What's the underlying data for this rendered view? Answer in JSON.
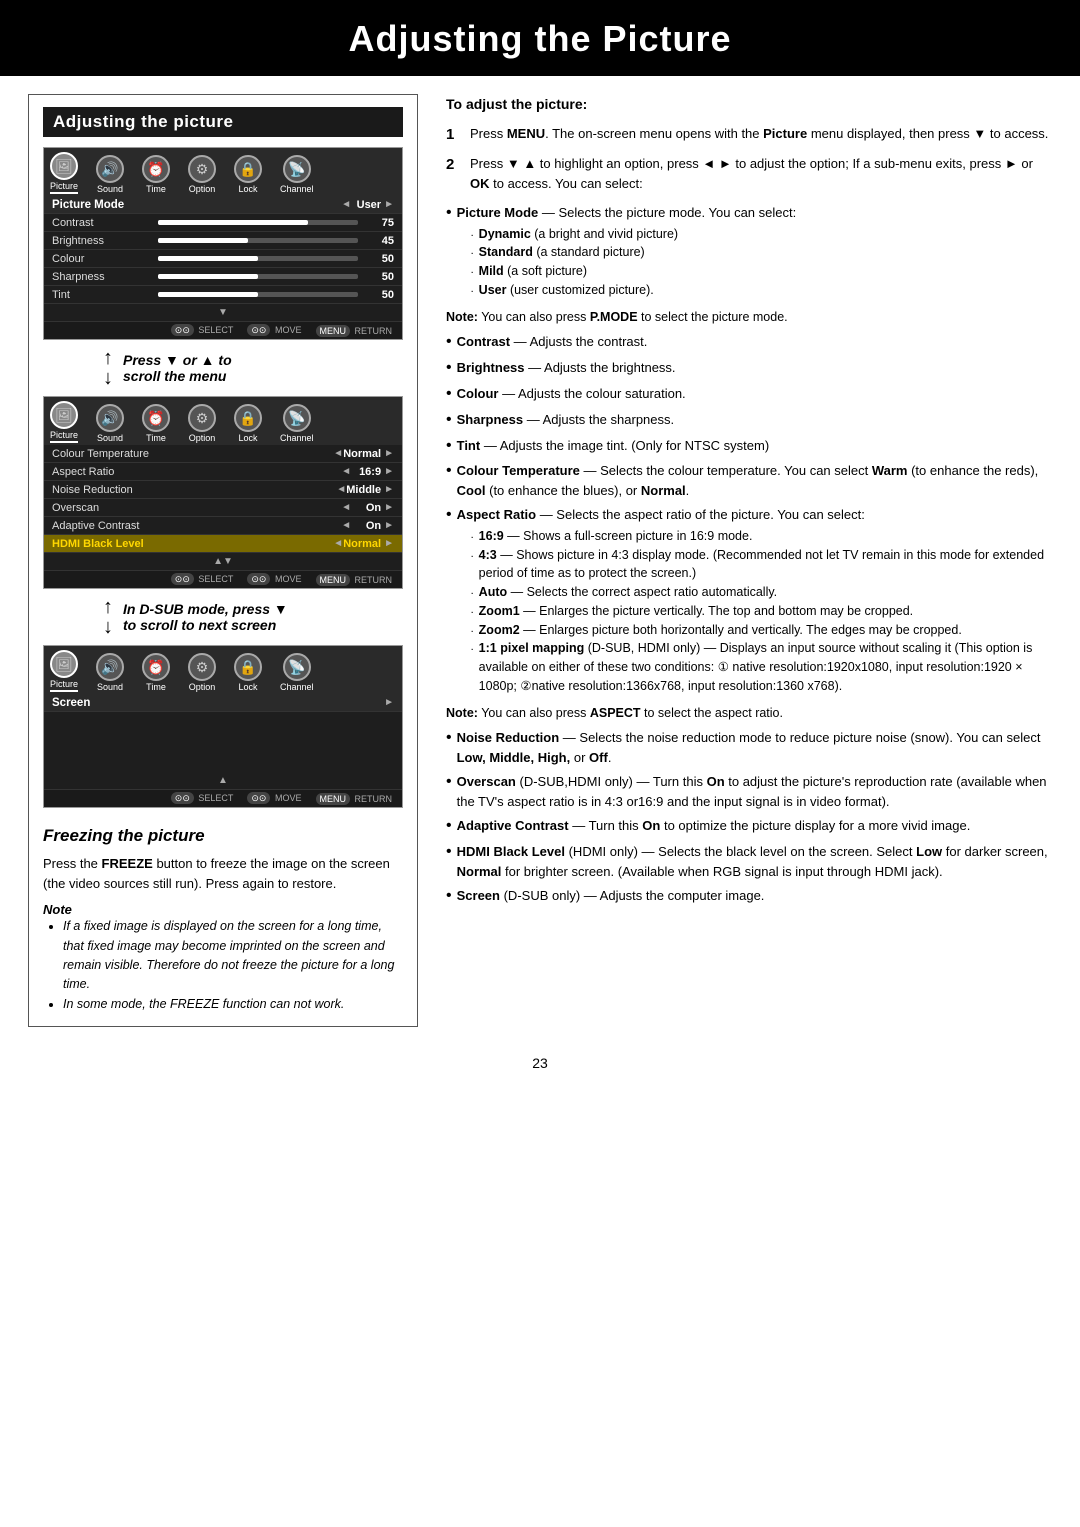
{
  "page": {
    "title": "Adjusting the Picture",
    "number": "23"
  },
  "left_section": {
    "header": "Adjusting the picture",
    "menu1": {
      "icons": [
        {
          "label": "Picture",
          "active": true
        },
        {
          "label": "Sound",
          "active": false
        },
        {
          "label": "Time",
          "active": false
        },
        {
          "label": "Option",
          "active": false
        },
        {
          "label": "Lock",
          "active": false
        },
        {
          "label": "Channel",
          "active": false
        }
      ],
      "rows": [
        {
          "label": "Picture Mode",
          "left_arrow": true,
          "value": "User",
          "right_arrow": true,
          "bar": false,
          "highlight": false,
          "bold_label": true
        },
        {
          "label": "Contrast",
          "left_arrow": false,
          "value": "75",
          "bar": true,
          "bar_pct": 75,
          "highlight": false,
          "bold_label": false
        },
        {
          "label": "Brightness",
          "left_arrow": false,
          "value": "45",
          "bar": true,
          "bar_pct": 45,
          "highlight": false,
          "bold_label": false
        },
        {
          "label": "Colour",
          "left_arrow": false,
          "value": "50",
          "bar": true,
          "bar_pct": 50,
          "highlight": false,
          "bold_label": false
        },
        {
          "label": "Sharpness",
          "left_arrow": false,
          "value": "50",
          "bar": true,
          "bar_pct": 50,
          "highlight": false,
          "bold_label": false
        },
        {
          "label": "Tint",
          "left_arrow": false,
          "value": "50",
          "bar": true,
          "bar_pct": 50,
          "highlight": false,
          "bold_label": false
        }
      ],
      "bottom": [
        "SELECT",
        "MOVE",
        "RETURN"
      ]
    },
    "scroll1": {
      "text1": "Press",
      "arrow": "↕",
      "text2": "or",
      "arrow2": "↑",
      "text3": "to",
      "text4": "scroll the menu"
    },
    "menu2": {
      "icons": [
        {
          "label": "Picture",
          "active": true
        },
        {
          "label": "Sound",
          "active": false
        },
        {
          "label": "Time",
          "active": false
        },
        {
          "label": "Option",
          "active": false
        },
        {
          "label": "Lock",
          "active": false
        },
        {
          "label": "Channel",
          "active": false
        }
      ],
      "rows": [
        {
          "label": "Colour Temperature",
          "left_arrow": true,
          "value": "Normal",
          "right_arrow": true,
          "bar": false,
          "highlight": false,
          "bold_label": false
        },
        {
          "label": "Aspect Ratio",
          "left_arrow": true,
          "value": "16:9",
          "right_arrow": true,
          "bar": false,
          "highlight": false,
          "bold_label": false
        },
        {
          "label": "Noise Reduction",
          "left_arrow": true,
          "value": "Middle",
          "right_arrow": true,
          "bar": false,
          "highlight": false,
          "bold_label": false
        },
        {
          "label": "Overscan",
          "left_arrow": true,
          "value": "On",
          "right_arrow": true,
          "bar": false,
          "highlight": false,
          "bold_label": false
        },
        {
          "label": "Adaptive Contrast",
          "left_arrow": true,
          "value": "On",
          "right_arrow": true,
          "bar": false,
          "highlight": false,
          "bold_label": false
        },
        {
          "label": "HDMI Black Level",
          "left_arrow": true,
          "value": "Normal",
          "right_arrow": true,
          "bar": false,
          "highlight": true,
          "bold_label": false,
          "highlight_color": "#b8860b"
        }
      ],
      "bottom": [
        "SELECT",
        "MOVE",
        "RETURN"
      ]
    },
    "scroll2": {
      "text": "In D-SUB mode, press ▼ to scroll to next screen"
    },
    "menu3": {
      "icons": [
        {
          "label": "Picture",
          "active": true
        },
        {
          "label": "Sound",
          "active": false
        },
        {
          "label": "Time",
          "active": false
        },
        {
          "label": "Option",
          "active": false
        },
        {
          "label": "Lock",
          "active": false
        },
        {
          "label": "Channel",
          "active": false
        }
      ],
      "rows": [
        {
          "label": "Screen",
          "value": "",
          "right_arrow": true,
          "bar": false,
          "highlight": false,
          "bold_label": false
        }
      ],
      "bottom": [
        "SELECT",
        "MOVE",
        "RETURN"
      ]
    }
  },
  "freezing_section": {
    "title": "Freezing the picture",
    "text": "Press the FREEZE button to freeze the image on the screen (the video sources still run). Press again to restore.",
    "note_title": "Note",
    "notes": [
      "If a fixed image is displayed on the screen for a long time, that fixed image may become imprinted on the screen and remain visible. Therefore do not freeze the picture for a long time.",
      "In some mode, the FREEZE function can not work."
    ]
  },
  "right_section": {
    "section_title": "To adjust the picture:",
    "steps": [
      {
        "num": "1",
        "text": "Press MENU. The on-screen menu opens with the Picture menu displayed, then press ▼ to access."
      },
      {
        "num": "2",
        "text": "Press ▼ ▲ to highlight an option, press ◄ ► to adjust the option; If a sub-menu exits, press ► or OK to access. You can select:"
      }
    ],
    "bullets": [
      {
        "main": "Picture Mode — Selects the picture mode. You can select:",
        "sub": [
          "Dynamic (a bright and vivid picture)",
          "Standard (a standard picture)",
          "Mild (a soft picture)",
          "User (user customized picture)."
        ]
      },
      {
        "main": "Note: You can also press P.MODE to select the picture mode.",
        "note": true,
        "sub": []
      },
      {
        "main": "Contrast — Adjusts the contrast.",
        "sub": []
      },
      {
        "main": "Brightness — Adjusts the brightness.",
        "sub": []
      },
      {
        "main": "Colour — Adjusts the colour saturation.",
        "sub": []
      },
      {
        "main": "Sharpness — Adjusts the sharpness.",
        "sub": []
      },
      {
        "main": "Tint — Adjusts the image tint. (Only for NTSC system)",
        "sub": []
      },
      {
        "main": "Colour Temperature — Selects the colour temperature. You can select Warm (to enhance the reds), Cool (to enhance the blues), or Normal.",
        "sub": []
      },
      {
        "main": "Aspect Ratio — Selects the aspect ratio of the picture. You can select:",
        "sub": [
          "16:9 — Shows a full-screen picture in 16:9 mode.",
          "4:3 — Shows picture in 4:3 display mode. (Recommended not let TV remain in this mode for extended period of time as to protect the screen.)",
          "Auto — Selects the correct aspect ratio automatically.",
          "Zoom1 — Enlarges the picture vertically. The top and bottom may be cropped.",
          "Zoom2 — Enlarges picture both horizontally and vertically. The edges may be cropped.",
          "1:1 pixel mapping (D-SUB, HDMI only) — Displays an input source without scaling it (This option is available on either of these two conditions: ① native resolution:1920x1080, input resolution:1920 × 1080p; ②native resolution:1366x768, input resolution:1360 x768)."
        ]
      },
      {
        "main": "Note: You can also press ASPECT to select the aspect ratio.",
        "note": true,
        "sub": []
      },
      {
        "main": "Noise Reduction — Selects the noise reduction mode to reduce picture noise (snow). You can select Low, Middle, High, or Off.",
        "sub": []
      },
      {
        "main": "Overscan (D-SUB,HDMI only) — Turn this On to adjust the picture's reproduction rate (available when the TV's aspect ratio is in 4:3 or16:9 and the input signal is in video format).",
        "sub": []
      },
      {
        "main": "Adaptive Contrast — Turn this On to optimize the picture display for a more vivid image.",
        "sub": []
      },
      {
        "main": "HDMI Black Level (HDMI only) — Selects the black level on the screen. Select Low for darker screen, Normal for brighter screen. (Available when RGB signal is input through HDMI jack).",
        "sub": []
      },
      {
        "main": "Screen (D-SUB only) — Adjusts the computer image.",
        "sub": []
      }
    ]
  }
}
